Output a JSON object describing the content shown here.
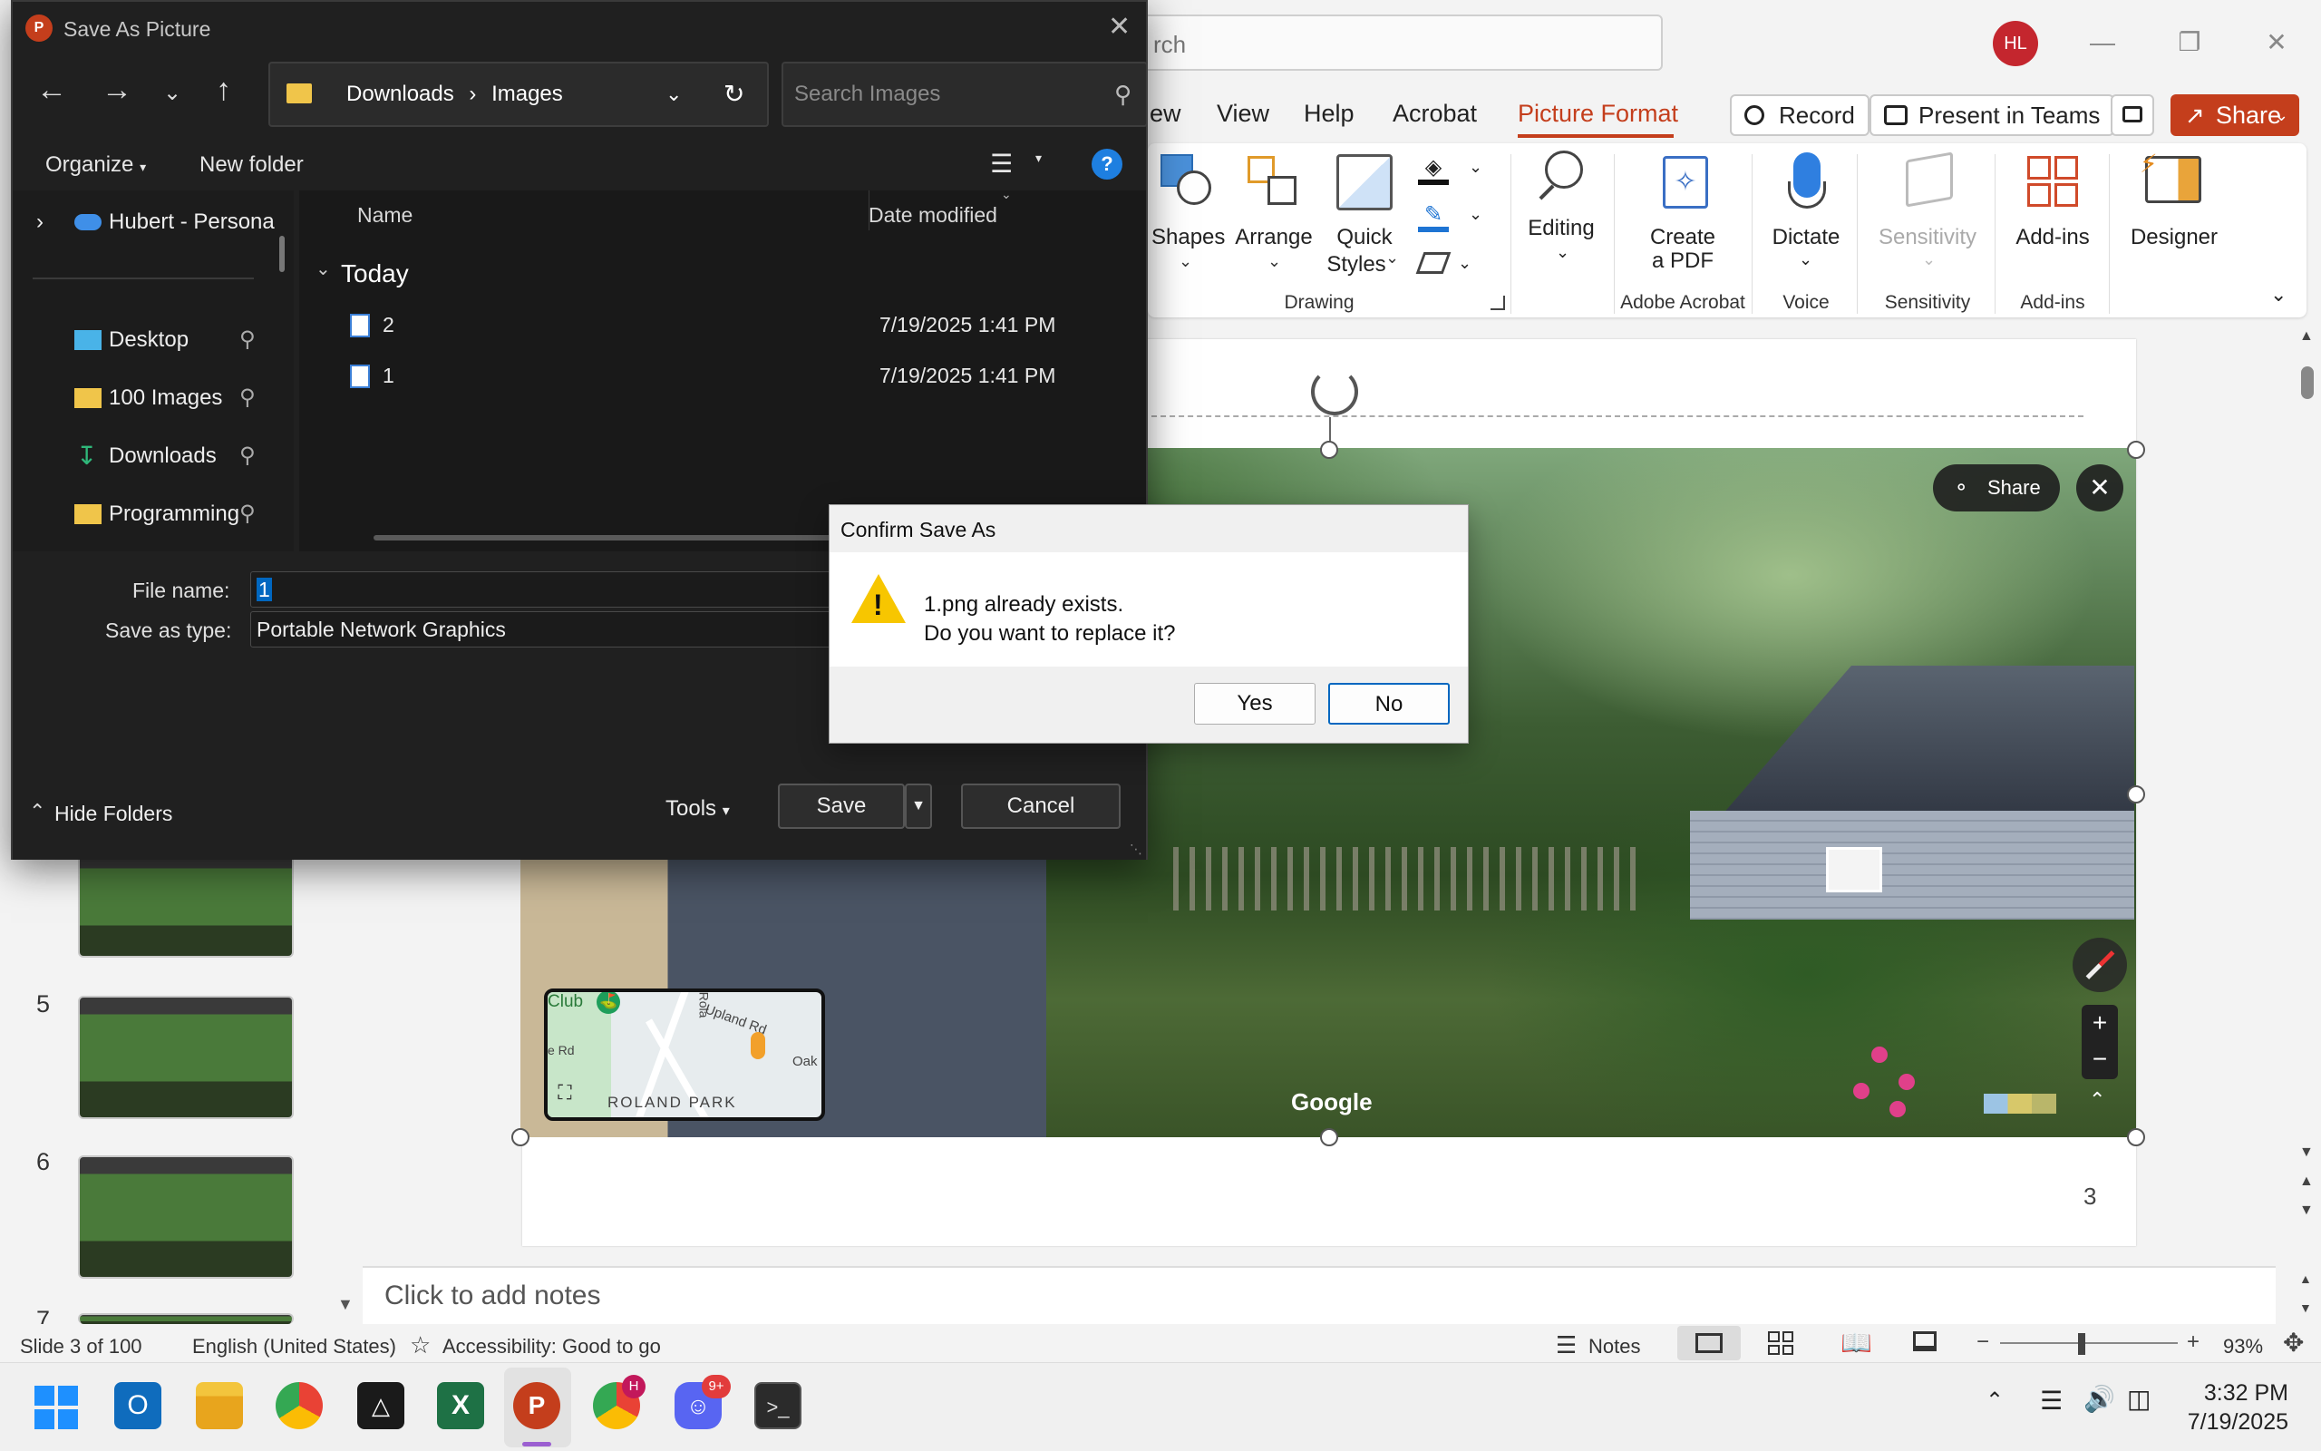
{
  "powerpoint": {
    "search_placeholder": "rch",
    "avatar_initials": "HL",
    "menu": [
      "ew",
      "View",
      "Help",
      "Acrobat",
      "Picture Format"
    ],
    "active_menu": "Picture Format",
    "record_label": "Record",
    "present_teams_label": "Present in Teams",
    "share_label": "Share",
    "ribbon": {
      "shapes": "Shapes",
      "arrange": "Arrange",
      "quick_styles_1": "Quick",
      "quick_styles_2": "Styles",
      "editing": "Editing",
      "create_pdf_1": "Create",
      "create_pdf_2": "a PDF",
      "dictate": "Dictate",
      "sensitivity": "Sensitivity",
      "addins": "Add-ins",
      "designer": "Designer",
      "groups": {
        "drawing": "Drawing",
        "adobe": "Adobe Acrobat",
        "voice": "Voice",
        "sensitivity": "Sensitivity",
        "addins": "Add-ins"
      }
    },
    "thumbnails": [
      {
        "num": "5"
      },
      {
        "num": "6"
      },
      {
        "num": "7"
      }
    ],
    "slide": {
      "page_number": "3",
      "streetview": {
        "share": "Share",
        "google_logo": "Google",
        "map_labels": {
          "club": "Club",
          "upland": "Upland Rd",
          "roland": "Rola",
          "roland_park": "ROLAND PARK",
          "oak": "Oak",
          "rd": "e Rd"
        }
      }
    },
    "notes_placeholder": "Click to add notes",
    "status": {
      "slide_info": "Slide 3 of 100",
      "language": "English (United States)",
      "accessibility": "Accessibility: Good to go",
      "notes": "Notes",
      "zoom": "93%"
    }
  },
  "save_as": {
    "title": "Save As Picture",
    "breadcrumb": [
      "Downloads",
      "Images"
    ],
    "search_placeholder": "Search Images",
    "organize": "Organize",
    "new_folder": "New folder",
    "nav_items": [
      {
        "label": "Hubert - Persona"
      },
      {
        "label": "Desktop"
      },
      {
        "label": "100 Images"
      },
      {
        "label": "Downloads"
      },
      {
        "label": "Programming"
      }
    ],
    "columns": {
      "name": "Name",
      "date": "Date modified"
    },
    "group_label": "Today",
    "files": [
      {
        "name": "2",
        "date": "7/19/2025 1:41 PM"
      },
      {
        "name": "1",
        "date": "7/19/2025 1:41 PM"
      }
    ],
    "file_name_label": "File name:",
    "file_name_value": "1",
    "type_label": "Save as type:",
    "type_value": "Portable Network Graphics",
    "hide_folders": "Hide Folders",
    "tools": "Tools",
    "save": "Save",
    "cancel": "Cancel"
  },
  "confirm": {
    "title": "Confirm Save As",
    "line1": "1.png already exists.",
    "line2": "Do you want to replace it?",
    "yes": "Yes",
    "no": "No"
  },
  "taskbar": {
    "time": "3:32 PM",
    "date": "7/19/2025",
    "discord_badge": "9+",
    "chrome_badge": "H"
  },
  "colors": {
    "accent": "#c43e1c",
    "dialog_bg": "#202020",
    "selection": "#0067c0"
  }
}
